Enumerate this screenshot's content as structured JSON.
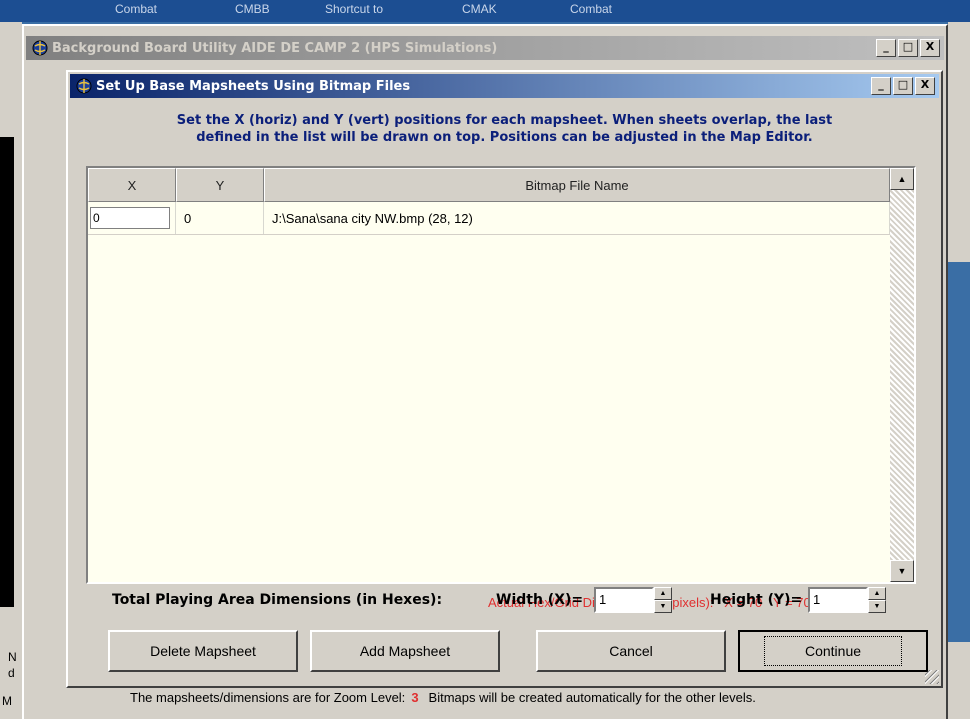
{
  "desktop": {
    "top_labels": [
      "Combat",
      "CMBB",
      "Shortcut to",
      "CMAK",
      "Combat"
    ],
    "left_glyphs": [
      "N",
      "d",
      "M"
    ]
  },
  "outer_window": {
    "title": "Background Board Utility  AIDE DE CAMP 2  (HPS Simulations)",
    "controls": {
      "minimize": "_",
      "maximize": "□",
      "close": "X"
    }
  },
  "dialog": {
    "title": "Set Up Base Mapsheets Using Bitmap Files",
    "controls": {
      "minimize": "_",
      "maximize": "□",
      "close": "X"
    },
    "instructions_line1": "Set the X (horiz) and Y (vert) positions for each mapsheet.  When sheets overlap, the last",
    "instructions_line2": "defined in the list will be drawn on top.  Positions can be adjusted in the Map Editor.",
    "table": {
      "columns": [
        "X",
        "Y",
        "Bitmap File Name"
      ],
      "rows": [
        {
          "x": "0",
          "y": "0",
          "file": "J:\\Sana\\sana city NW.bmp  (28, 12)"
        }
      ]
    },
    "hex_dims": {
      "label": "Actual Hex/Grid Dimensions (in pixels):",
      "x": "X = 70",
      "y": "Y = 70"
    },
    "totals": {
      "label": "Total Playing Area Dimensions (in Hexes):",
      "width_label": "Width (X)=",
      "width_value": "1",
      "height_label": "Height (Y)=",
      "height_value": "1"
    },
    "buttons": {
      "delete": "Delete Mapsheet",
      "add": "Add Mapsheet",
      "cancel": "Cancel",
      "continue": "Continue"
    },
    "zoom": {
      "prefix": "The mapsheets/dimensions are for Zoom Level:",
      "level": "3",
      "suffix": "Bitmaps will be created automatically for the other levels."
    }
  }
}
